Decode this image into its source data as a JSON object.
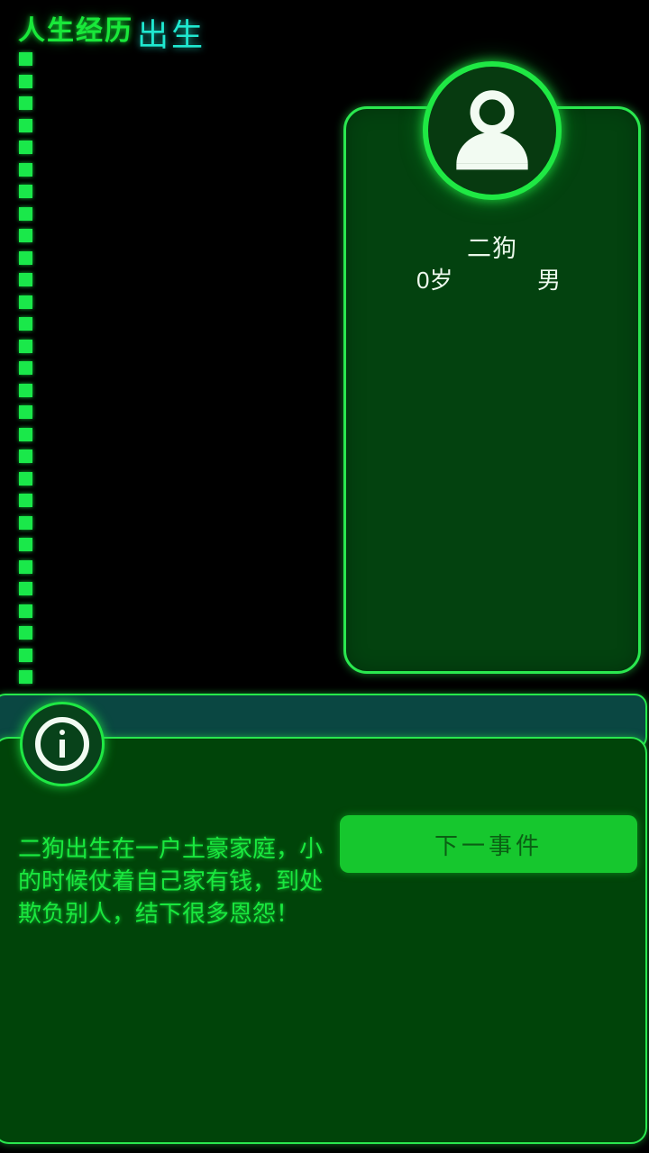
{
  "page": {
    "title": "人生经历",
    "background_color": "#000000",
    "accent_green": "#1ae84a",
    "accent_cyan": "#1fe8d0"
  },
  "timeline": {
    "name": "life-timeline",
    "dash_count": 29,
    "dash_color": "#1ae84a"
  },
  "profile": {
    "avatar_icon": "person-avatar-icon",
    "name": "二狗",
    "age": "0岁",
    "gender": "男",
    "border_color": "#2ae84f",
    "fill_color": "#03420f"
  },
  "event": {
    "info_icon": "info-circle-icon",
    "title": "出生",
    "title_color": "#1fe8d0",
    "body_text": "二狗出生在一户土豪家庭，小的时候仗着自己家有钱，到处欺负别人，结下很多恩怨！",
    "body_text_color": "#1ae83f",
    "next_button_label": "下一事件",
    "next_button_color": "#16c72e",
    "next_button_text_color": "#0b5f14"
  }
}
